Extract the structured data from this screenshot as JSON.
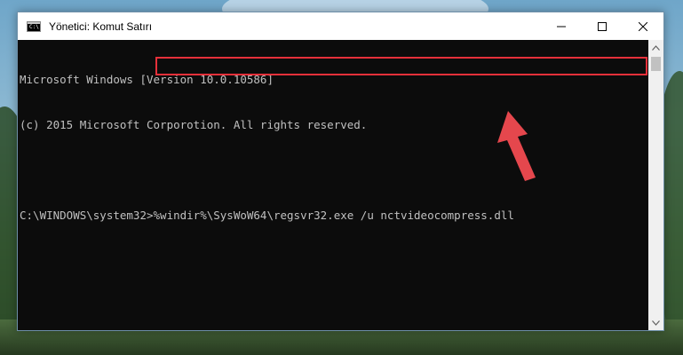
{
  "window": {
    "title": "Yönetici: Komut Satırı",
    "icon": "cmd-icon",
    "icon_label": "C:\\",
    "controls": [
      "minimize-icon",
      "maximize-icon",
      "close-icon"
    ]
  },
  "console": {
    "line1": "Microsoft Windows [Version 10.0.10586]",
    "line2": "(c) 2015 Microsoft Corporotion. All rights reserved.",
    "line3": "",
    "prompt": "C:\\WINDOWS\\system32>",
    "command": "%windir%\\SysWoW64\\regsvr32.exe /u nctvideocompress.dll"
  },
  "annotation": {
    "highlight_color": "#e5303a",
    "arrow_color": "#e5474d",
    "arrow_icon": "arrow-pointer-icon"
  }
}
